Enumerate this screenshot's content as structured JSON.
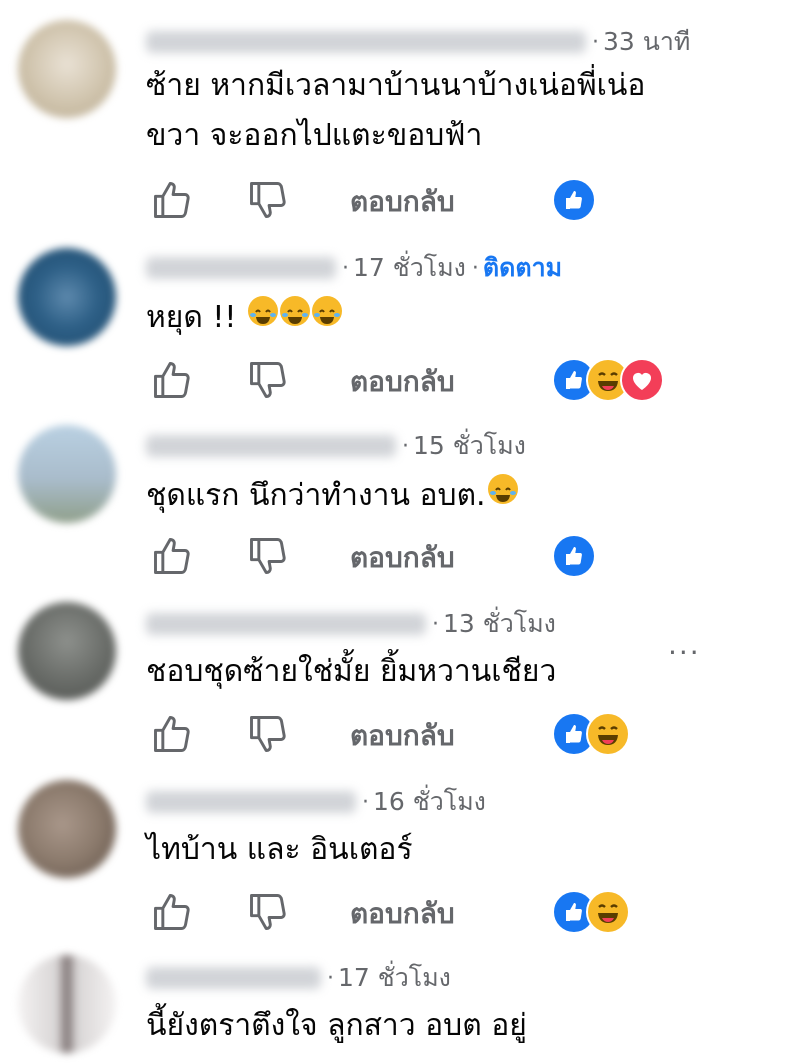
{
  "comments": [
    {
      "time": "33 นาที",
      "lines": [
        "ซ้าย หากมีเวลามาบ้านนาบ้างเน่อพี่เน่อ",
        "ขวา จะออกไปแตะขอบฟ้า"
      ],
      "reply_label": "ตอบกลับ",
      "reactions": [
        "like"
      ],
      "avatar_color": "#d8ccb8"
    },
    {
      "time": "17 ชั่วโมง",
      "follow_label": "ติดตาม",
      "lines": [
        "หยุด !!"
      ],
      "text_emojis": [
        "rofl",
        "rofl",
        "rofl"
      ],
      "reply_label": "ตอบกลับ",
      "reactions": [
        "like",
        "haha",
        "love"
      ],
      "avatar_color": "#2d5f86"
    },
    {
      "time": "15 ชั่วโมง",
      "lines": [
        "ชุดแรก นึกว่าทำงาน อบต."
      ],
      "text_emojis": [
        "rofl"
      ],
      "reply_label": "ตอบกลับ",
      "reactions": [
        "like"
      ],
      "avatar_color": "#a9bccb"
    },
    {
      "time": "13 ชั่วโมง",
      "lines": [
        "ชอบชุดซ้ายใช่มั้ย ยิ้มหวานเชียว"
      ],
      "reply_label": "ตอบกลับ",
      "reactions": [
        "like",
        "haha"
      ],
      "avatar_color": "#6b6e6a",
      "more_label": "···"
    },
    {
      "time": "16 ชั่วโมง",
      "lines": [
        "ไทบ้าน และ อินเตอร์"
      ],
      "reply_label": "ตอบกลับ",
      "reactions": [
        "like",
        "haha"
      ],
      "avatar_color": "#8b7a6c"
    },
    {
      "time": "17 ชั่วโมง",
      "lines": [
        "นี้ยังตราตึงใจ ลูกสาว อบต อยู่"
      ],
      "avatar_color": "#d9d6d6"
    }
  ],
  "colors": {
    "accent": "#1877f2",
    "secondary_text": "#65676b",
    "haha": "#f7b928",
    "love": "#f33e58"
  },
  "icons": {
    "like_action": "thumbs-up-outline-icon",
    "dislike_action": "thumbs-down-outline-icon",
    "more": "ellipsis-icon"
  }
}
